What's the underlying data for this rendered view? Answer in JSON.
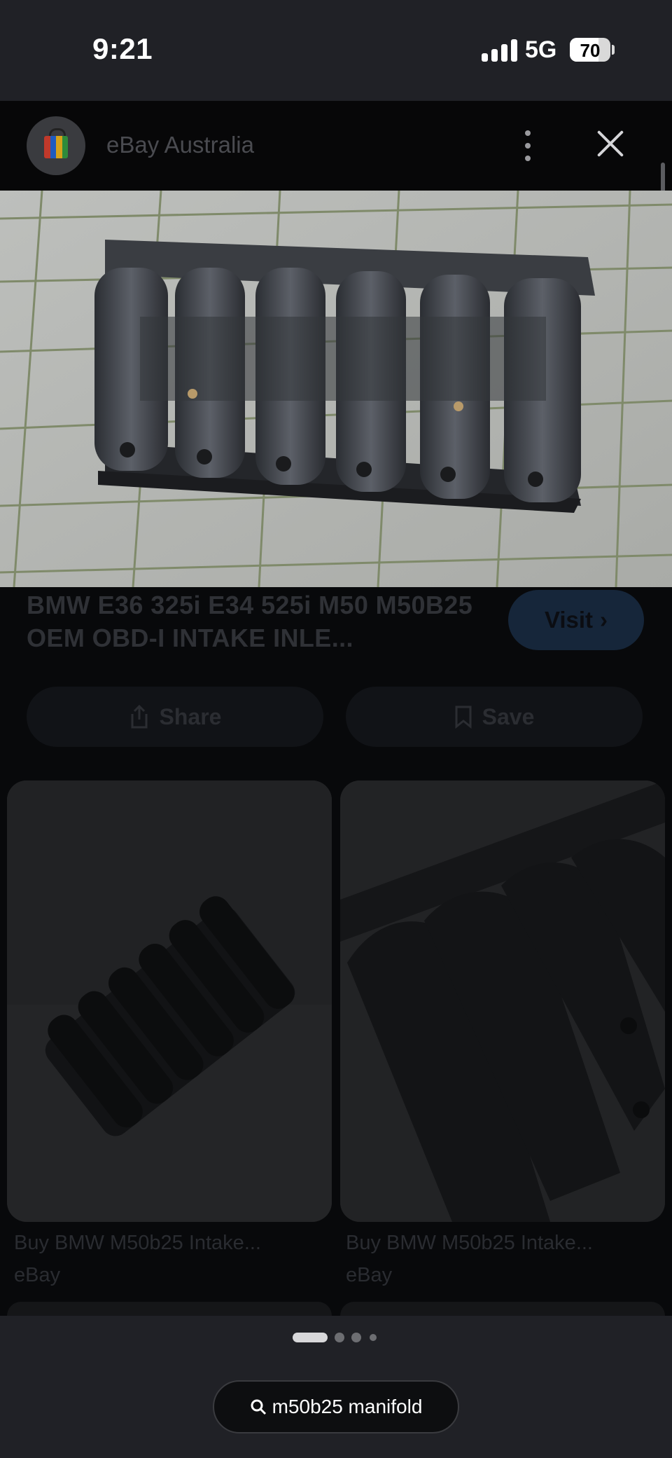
{
  "status_bar": {
    "time": "9:21",
    "network": "5G",
    "battery": "70"
  },
  "header": {
    "site_name": "eBay Australia"
  },
  "result": {
    "title": "BMW E36 325i E34 525i M50 M50B25 OEM OBD-I INTAKE INLE...",
    "visit_label": "Visit",
    "share_label": "Share",
    "save_label": "Save"
  },
  "related": [
    {
      "title": "Buy BMW M50b25 Intake...",
      "source": "eBay"
    },
    {
      "title": "Buy BMW M50b25 Intake...",
      "source": "eBay"
    }
  ],
  "pager": {
    "current": 1,
    "total": 4
  },
  "search": {
    "query": "m50b25 manifold"
  },
  "colors": {
    "visit_button": "#16263a",
    "background": "#202126",
    "sheet": "#08090b"
  }
}
